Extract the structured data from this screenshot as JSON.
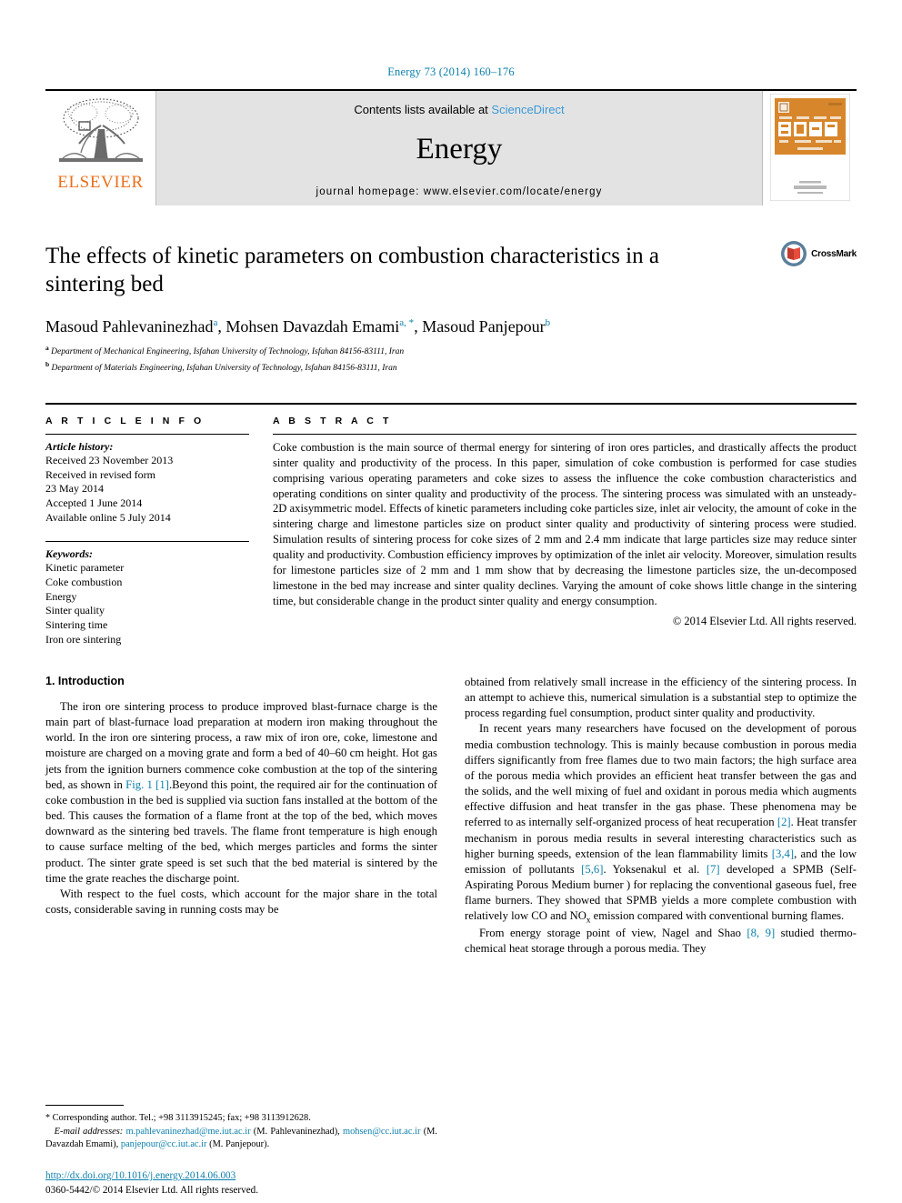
{
  "running_head": "Energy 73 (2014) 160–176",
  "masthead": {
    "publisher_name": "ELSEVIER",
    "contents_prefix": "Contents lists available at",
    "sciencedirect": "ScienceDirect",
    "journal_name": "Energy",
    "homepage": "journal homepage: www.elsevier.com/locate/energy",
    "cover_title": "ENERGY",
    "accent_orange": "#E9711C",
    "accent_blue": "#0b7fab",
    "sciencedirect_blue": "#3a9ad9",
    "masthead_bg": "#e3e3e3"
  },
  "article": {
    "title": "The effects of kinetic parameters on combustion characteristics in a sintering bed",
    "crossmark_label": "CrossMark",
    "authors": [
      {
        "name": "Masoud Pahlevaninezhad",
        "marks": "a"
      },
      {
        "name": "Mohsen Davazdah Emami",
        "marks": "a, *"
      },
      {
        "name": "Masoud Panjepour",
        "marks": "b"
      }
    ],
    "affiliations": [
      {
        "mark": "a",
        "text": "Department of Mechanical Engineering, Isfahan University of Technology, Isfahan 84156-83111, Iran"
      },
      {
        "mark": "b",
        "text": "Department of Materials Engineering, Isfahan University of Technology, Isfahan 84156-83111, Iran"
      }
    ]
  },
  "article_info": {
    "heading": "A R T I C L E   I N F O",
    "history_label": "Article history:",
    "history": [
      "Received 23 November 2013",
      "Received in revised form",
      "23 May 2014",
      "Accepted 1 June 2014",
      "Available online 5 July 2014"
    ],
    "keywords_label": "Keywords:",
    "keywords": [
      "Kinetic parameter",
      "Coke combustion",
      "Energy",
      "Sinter quality",
      "Sintering time",
      "Iron ore sintering"
    ]
  },
  "abstract": {
    "heading": "A B S T R A C T",
    "text": "Coke combustion is the main source of thermal energy for sintering of iron ores particles, and drastically affects the product sinter quality and productivity of the process. In this paper, simulation of coke combustion is performed for case studies comprising various operating parameters and coke sizes to assess the influence the coke combustion characteristics and operating conditions on sinter quality and productivity of the process. The sintering process was simulated with an unsteady-2D axisymmetric model. Effects of kinetic parameters including coke particles size, inlet air velocity, the amount of coke in the sintering charge and limestone particles size on product sinter quality and productivity of sintering process were studied. Simulation results of sintering process for coke sizes of 2 mm and 2.4 mm indicate that large particles size may reduce sinter quality and productivity. Combustion efficiency improves by optimization of the inlet air velocity. Moreover, simulation results for limestone particles size of 2 mm and 1 mm show that by decreasing the limestone particles size, the un-decomposed limestone in the bed may increase and sinter quality declines. Varying the amount of coke shows little change in the sintering time, but considerable change in the product sinter quality and energy consumption.",
    "copyright": "© 2014 Elsevier Ltd. All rights reserved."
  },
  "body": {
    "section_number_title": "1. Introduction",
    "left_p1_a": "The iron ore sintering process to produce improved blast-furnace charge is the main part of blast-furnace load preparation at modern iron making throughout the world. In the iron ore sintering process, a raw mix of iron ore, coke, limestone and moisture are charged on a moving grate and form a bed of 40–60 cm height. Hot gas jets from the ignition burners commence coke combustion at the top of the sintering bed, as shown in ",
    "left_p1_fig_link": "Fig. 1",
    "left_p1_ref_link": "[1]",
    "left_p1_b": ".Beyond this point, the required air for the continuation of coke combustion in the bed is supplied via suction fans installed at the bottom of the bed. This causes the formation of a flame front at the top of the bed, which moves downward as the sintering bed travels. The flame front temperature is high enough to cause surface melting of the bed, which merges particles and forms the sinter product. The sinter grate speed is set such that the bed material is sintered by the time the grate reaches the discharge point.",
    "left_p2": "With respect to the fuel costs, which account for the major share in the total costs, considerable saving in running costs may be",
    "right_p1": "obtained from relatively small increase in the efficiency of the sintering process. In an attempt to achieve this, numerical simulation is a substantial step to optimize the process regarding fuel consumption, product sinter quality and productivity.",
    "right_p2_a": "In recent years many researchers have focused on the development of porous media combustion technology. This is mainly because combustion in porous media differs significantly from free flames due to two main factors; the high surface area of the porous media which provides an efficient heat transfer between the gas and the solids, and the well mixing of fuel and oxidant in porous media which augments effective diffusion and heat transfer in the gas phase. These phenomena may be referred to as internally self-organized process of heat recuperation ",
    "right_ref_2": "[2]",
    "right_p2_b": ". Heat transfer mechanism in porous media results in several interesting characteristics such as higher burning speeds, extension of the lean flammability limits ",
    "right_ref_34": "[3,4]",
    "right_p2_c": ", and the low emission of pollutants ",
    "right_ref_56": "[5,6]",
    "right_p2_d": ". Yoksenakul et al. ",
    "right_ref_7": "[7]",
    "right_p2_e": " developed a SPMB (Self-Aspirating Porous Medium burner ) for replacing the conventional gaseous fuel, free flame burners. They showed that SPMB yields a more complete combustion with relatively low CO and NO",
    "right_p2_sub": "x",
    "right_p2_f": " emission compared with conventional burning flames.",
    "right_p3_a": "From energy storage point of view, Nagel and Shao ",
    "right_ref_89": "[8, 9]",
    "right_p3_b": " studied thermo-chemical heat storage through a porous media. They"
  },
  "footnote": {
    "star": "*",
    "corresponding": "Corresponding author. Tel.; +98 3113915245; fax; +98 3113912628.",
    "email_label": "E-mail addresses:",
    "emails": [
      {
        "address": "m.pahlevaninezhad@me.iut.ac.ir",
        "owner": "(M. Pahlevaninezhad),"
      },
      {
        "address": "mohsen@cc.iut.ac.ir",
        "owner": "(M. Davazdah Emami),"
      },
      {
        "address": "panjepour@cc.iut.ac.ir",
        "owner": "(M. Panjepour)."
      }
    ]
  },
  "doi_footer": {
    "doi": "http://dx.doi.org/10.1016/j.energy.2014.06.003",
    "issn_line": "0360-5442/© 2014 Elsevier Ltd. All rights reserved."
  }
}
